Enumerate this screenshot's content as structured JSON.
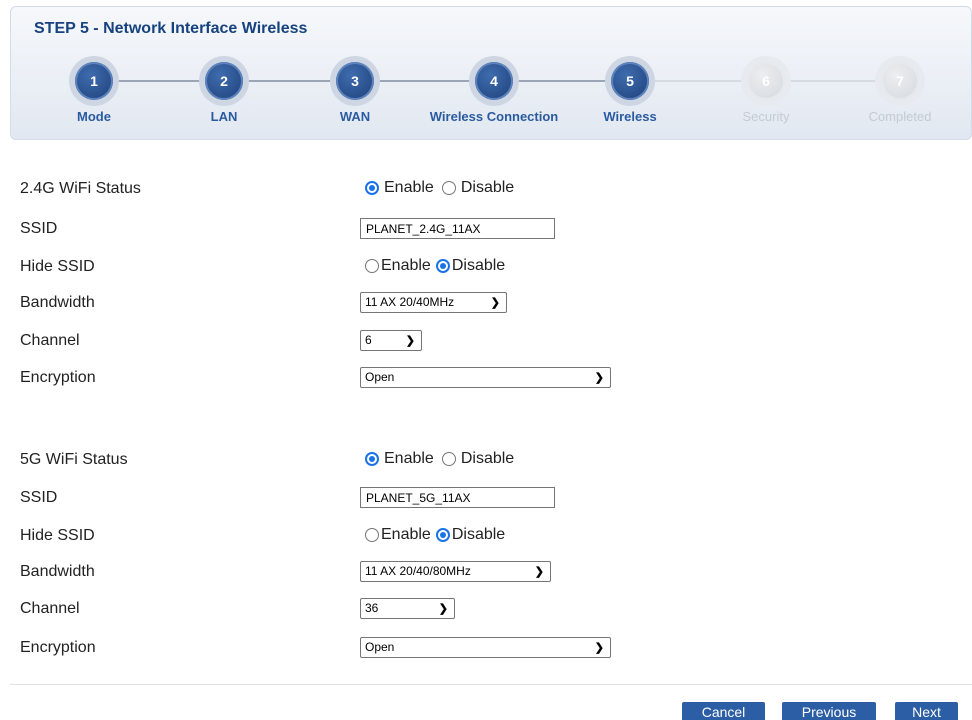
{
  "wizard": {
    "title": "STEP 5 - Network Interface Wireless",
    "steps": [
      {
        "number": "1",
        "label": "Mode",
        "state": "done"
      },
      {
        "number": "2",
        "label": "LAN",
        "state": "done"
      },
      {
        "number": "3",
        "label": "WAN",
        "state": "done"
      },
      {
        "number": "4",
        "label": "Wireless Connection",
        "state": "done"
      },
      {
        "number": "5",
        "label": "Wireless",
        "state": "current"
      },
      {
        "number": "6",
        "label": "Security",
        "state": "pending"
      },
      {
        "number": "7",
        "label": "Completed",
        "state": "pending"
      }
    ]
  },
  "band_24g": {
    "status_label": "2.4G WiFi Status",
    "status_enable": "Enable",
    "status_disable": "Disable",
    "status_value": "Enable",
    "ssid_label": "SSID",
    "ssid_value": "PLANET_2.4G_11AX",
    "hide_ssid_label": "Hide SSID",
    "hide_enable": "Enable",
    "hide_disable": "Disable",
    "hide_value": "Disable",
    "bandwidth_label": "Bandwidth",
    "bandwidth_value": "11 AX 20/40MHz",
    "channel_label": "Channel",
    "channel_value": "6",
    "encryption_label": "Encryption",
    "encryption_value": "Open"
  },
  "band_5g": {
    "status_label": "5G WiFi Status",
    "status_enable": "Enable",
    "status_disable": "Disable",
    "status_value": "Enable",
    "ssid_label": "SSID",
    "ssid_value": "PLANET_5G_11AX",
    "hide_ssid_label": "Hide SSID",
    "hide_enable": "Enable",
    "hide_disable": "Disable",
    "hide_value": "Disable",
    "bandwidth_label": "Bandwidth",
    "bandwidth_value": "11 AX 20/40/80MHz",
    "channel_label": "Channel",
    "channel_value": "36",
    "encryption_label": "Encryption",
    "encryption_value": "Open"
  },
  "buttons": {
    "cancel": "Cancel",
    "previous": "Previous",
    "next": "Next"
  },
  "colors": {
    "accent": "#1a73e8",
    "step_active": "#2a5ba0",
    "button": "#2b5ea4"
  }
}
